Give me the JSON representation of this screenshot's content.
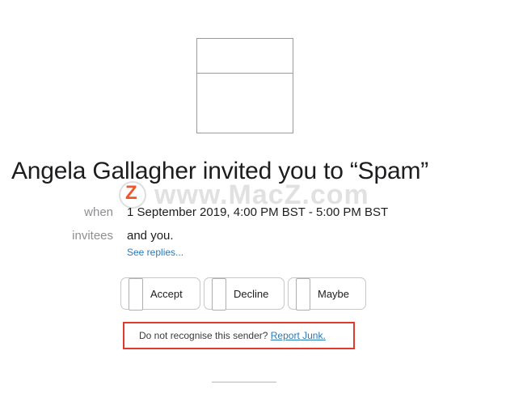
{
  "invite": {
    "title": "Angela Gallagher invited you to “Spam”",
    "when_label": "when",
    "when_value": "1 September 2019, 4:00 PM BST - 5:00 PM BST",
    "invitees_label": "invitees",
    "invitees_value": "and you.",
    "see_replies": "See replies..."
  },
  "rsvp": {
    "accept": "Accept",
    "decline": "Decline",
    "maybe": "Maybe"
  },
  "junk": {
    "prompt": "Do not recognise this sender? ",
    "link": "Report Junk."
  },
  "watermark": {
    "logo_letter": "Z",
    "text": "www.MacZ.com"
  },
  "colors": {
    "link": "#2a7ab8",
    "highlight_border": "#e03a2a",
    "watermark_logo": "#f0562a"
  },
  "icons": {
    "calendar": "calendar-icon"
  }
}
